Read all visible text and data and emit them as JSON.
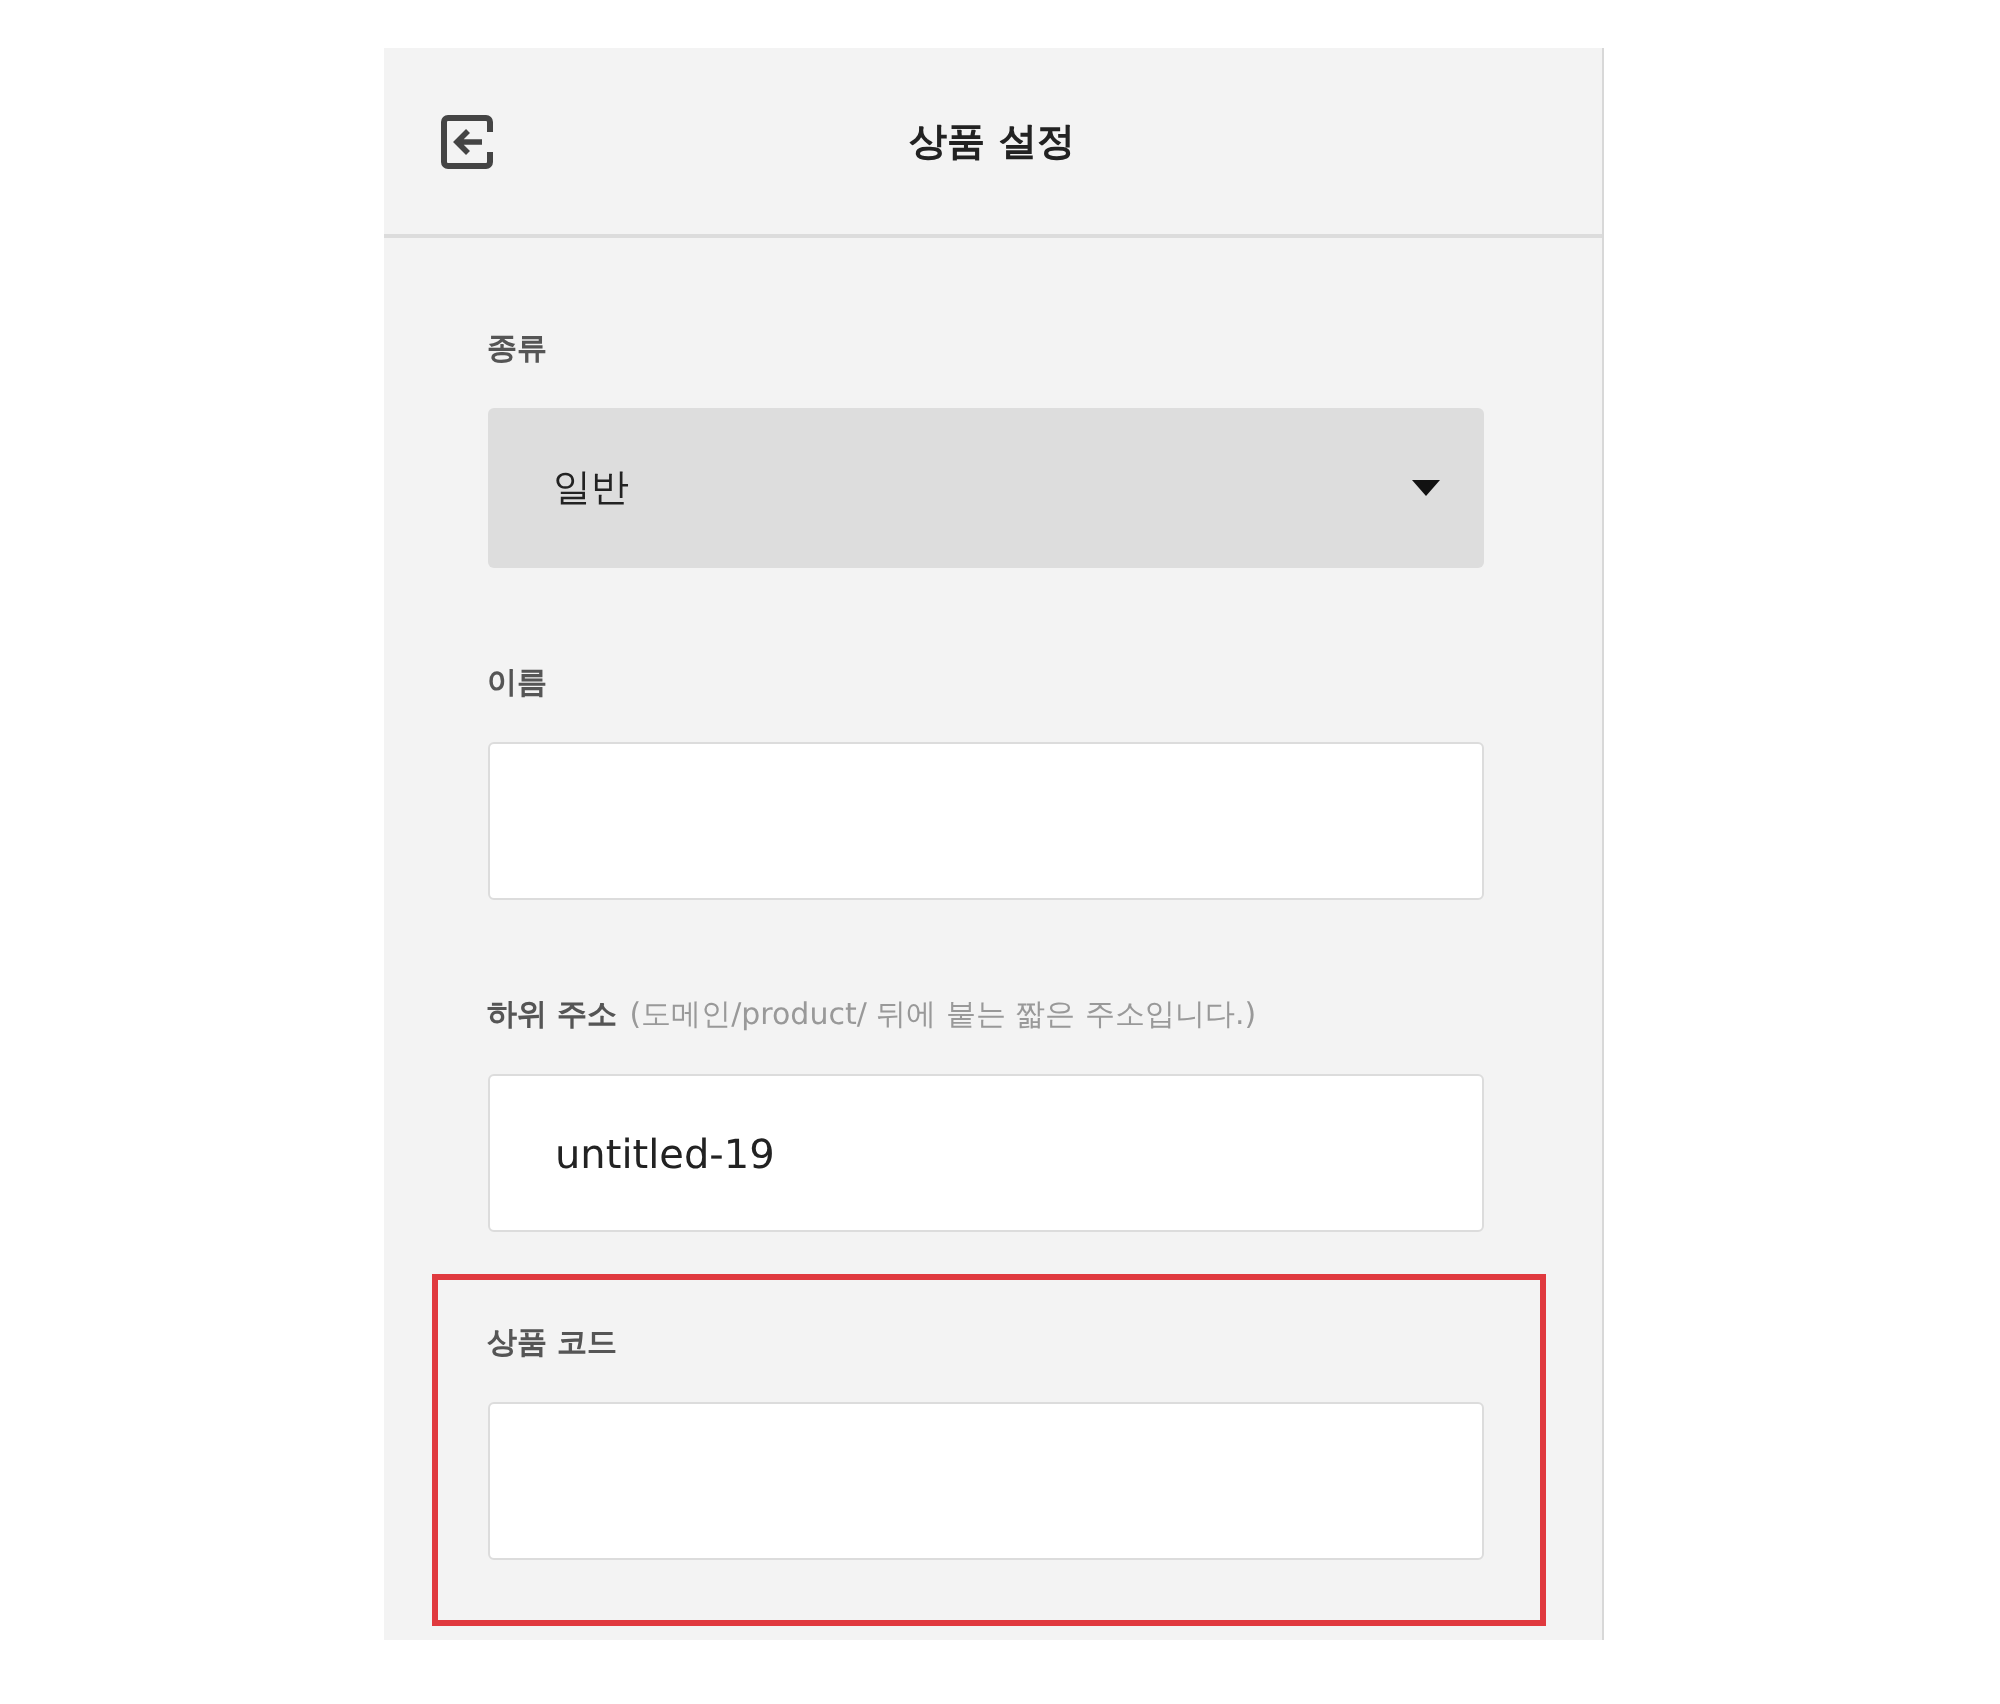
{
  "header": {
    "title": "상품 설정"
  },
  "fields": [
    {
      "kind": "select",
      "label": "종류",
      "value": "일반",
      "highlighted": false
    },
    {
      "kind": "text",
      "label": "이름",
      "highlighted": false
    },
    {
      "kind": "text",
      "label": "하위 주소",
      "hint": "(도메인/product/ 뒤에 붙는 짧은 주소입니다.)",
      "value": "untitled-19",
      "highlighted": false
    },
    {
      "kind": "text",
      "label": "상품 코드",
      "highlighted": true
    }
  ]
}
